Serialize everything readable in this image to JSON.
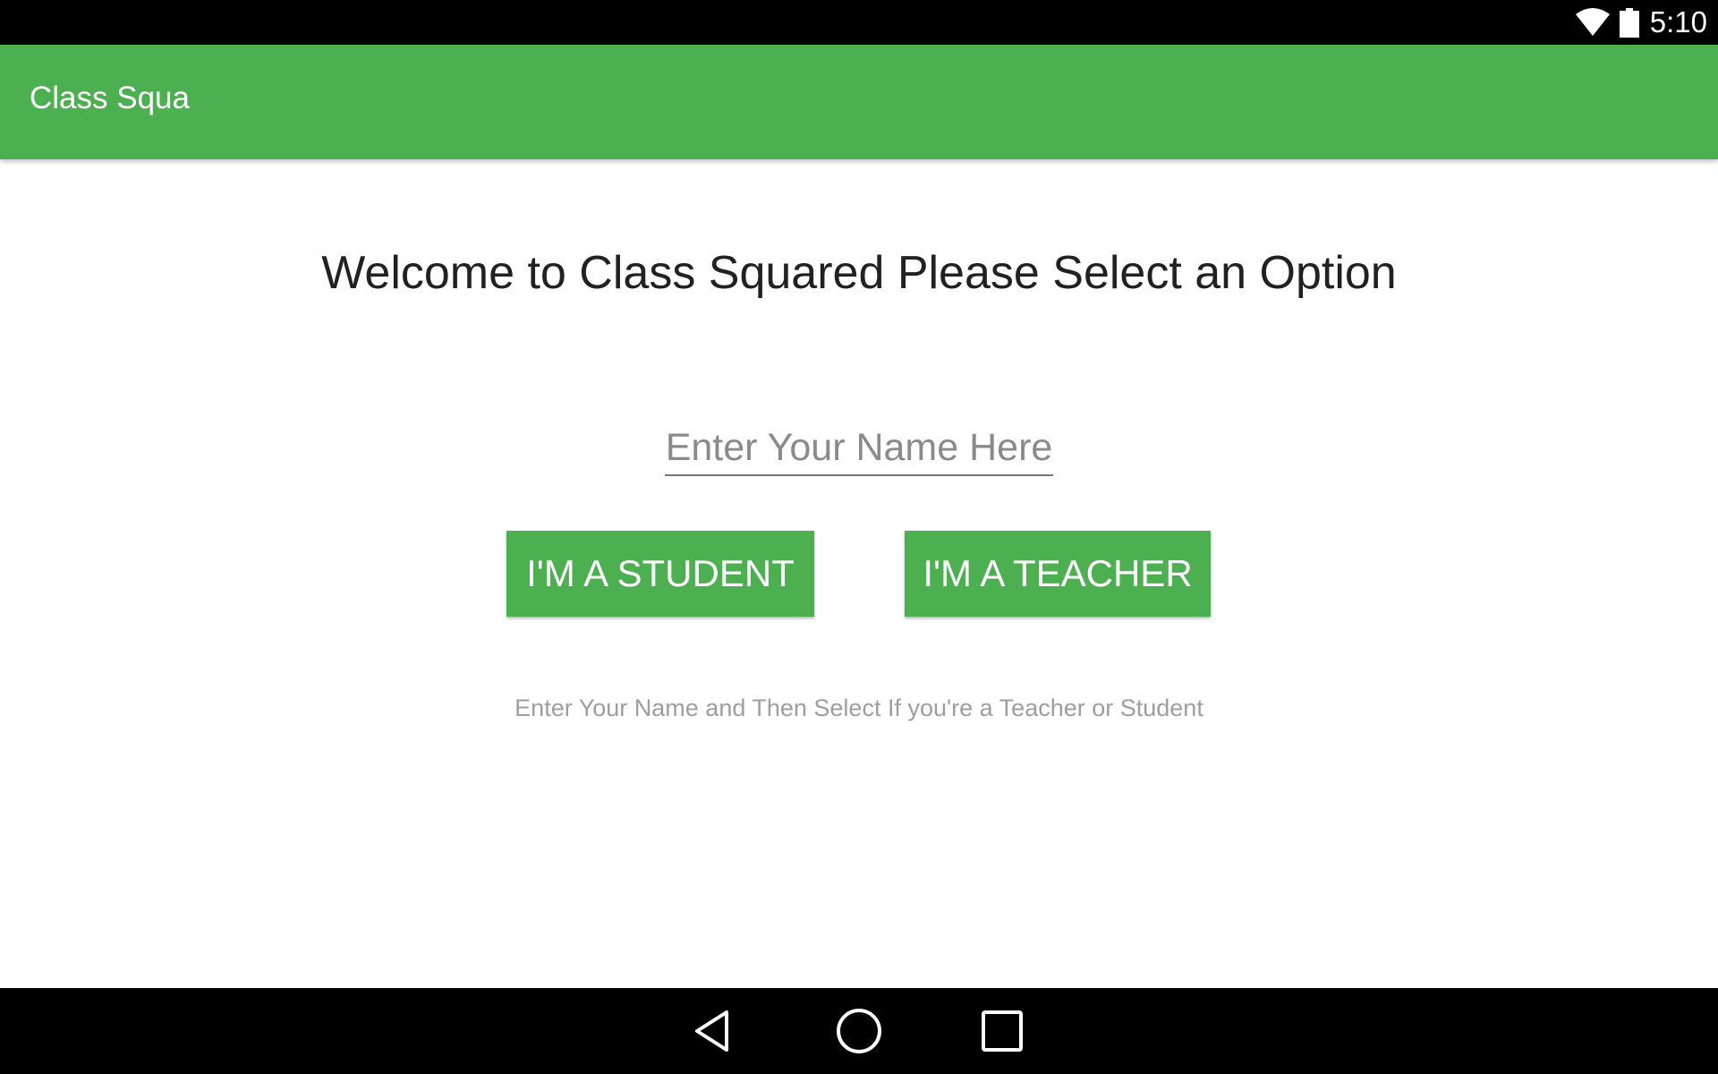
{
  "status_bar": {
    "time": "5:10",
    "icons": [
      "wifi-icon",
      "battery-icon"
    ]
  },
  "app_bar": {
    "title": "Class Squa"
  },
  "main": {
    "welcome_text": "Welcome to Class Squared Please Select an Option",
    "name_input": {
      "value": "",
      "placeholder": "Enter Your Name Here"
    },
    "student_button_label": "I'M A STUDENT",
    "teacher_button_label": "I'M A TEACHER",
    "hint_text": "Enter Your Name and Then Select If you're a Teacher or Student"
  },
  "nav_bar": {
    "icons": [
      "back-icon",
      "home-icon",
      "recents-icon"
    ]
  },
  "colors": {
    "accent": "#4caf50",
    "status_bar": "#000000",
    "nav_bar": "#000000",
    "text_primary": "#212121",
    "text_hint": "#9e9e9e"
  }
}
